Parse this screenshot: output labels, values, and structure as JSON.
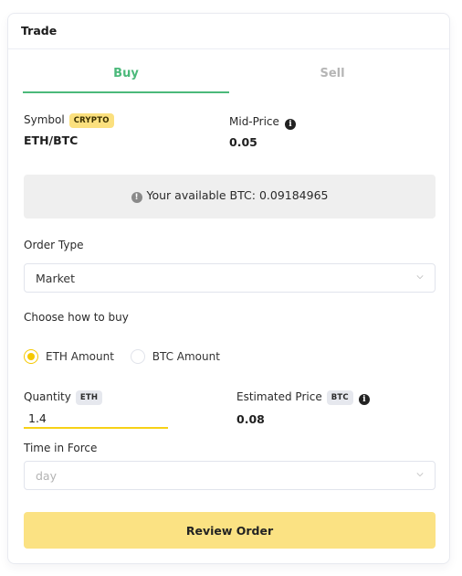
{
  "card": {
    "title": "Trade"
  },
  "tabs": [
    {
      "label": "Buy",
      "active": true
    },
    {
      "label": "Sell",
      "active": false
    }
  ],
  "symbol": {
    "label": "Symbol",
    "badge": "CRYPTO",
    "value": "ETH/BTC"
  },
  "mid_price": {
    "label": "Mid-Price",
    "info_icon": "info-icon",
    "value": "0.05"
  },
  "alert": {
    "icon": "exclamation-circle-icon",
    "text": "Your available BTC: 0.09184965"
  },
  "order_type": {
    "label": "Order Type",
    "selected": "Market"
  },
  "buy_method": {
    "label": "Choose how to buy",
    "options": [
      {
        "label": "ETH Amount",
        "checked": true
      },
      {
        "label": "BTC Amount",
        "checked": false
      }
    ]
  },
  "quantity": {
    "label": "Quantity",
    "badge": "ETH",
    "value": "1.4"
  },
  "estimated_price": {
    "label": "Estimated Price",
    "badge": "BTC",
    "info_icon": "info-icon",
    "value": "0.08"
  },
  "time_in_force": {
    "label": "Time in Force",
    "placeholder": "day"
  },
  "actions": {
    "review_label": "Review Order"
  },
  "colors": {
    "accent_green": "#4bb97a",
    "accent_yellow": "#f5c800",
    "button_yellow": "#fbe283",
    "badge_yellow": "#fbe07e"
  }
}
